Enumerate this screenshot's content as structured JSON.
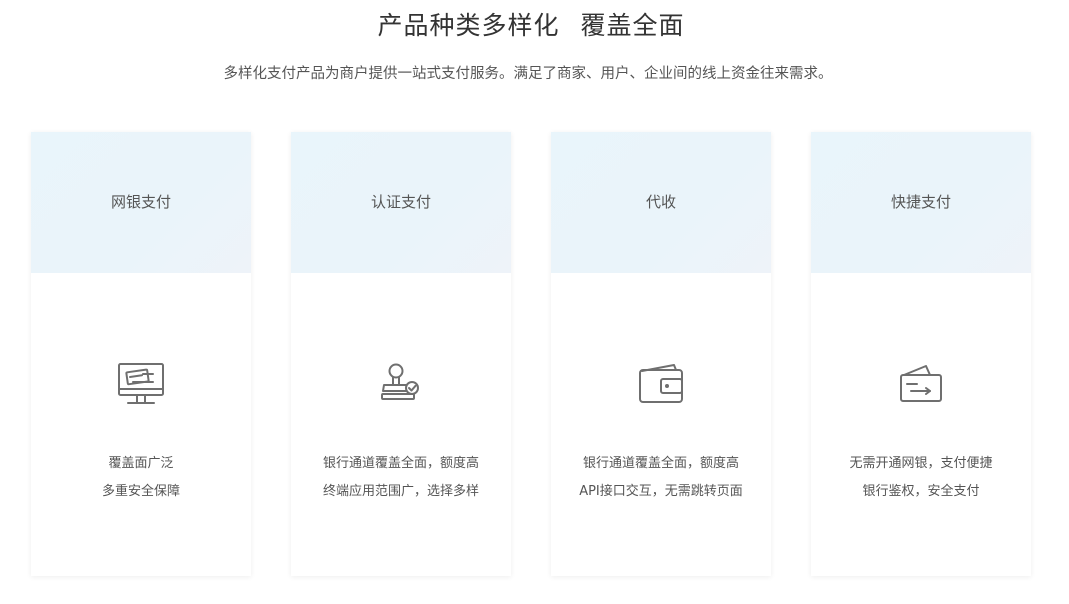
{
  "header": {
    "title": "产品种类多样化 覆盖全面",
    "subtitle": "多样化支付产品为商户提供一站式支付服务。满足了商家、用户、企业间的线上资金往来需求。"
  },
  "cards": [
    {
      "title": "网银支付",
      "icon": "monitor-card-icon",
      "line1": "覆盖面广泛",
      "line2": "多重安全保障"
    },
    {
      "title": "认证支付",
      "icon": "stamp-check-icon",
      "line1": "银行通道覆盖全面，额度高",
      "line2": "终端应用范围广，选择多样"
    },
    {
      "title": "代收",
      "icon": "wallet-icon",
      "line1": "银行通道覆盖全面，额度高",
      "line2": "API接口交互，无需跳转页面"
    },
    {
      "title": "快捷支付",
      "icon": "card-swipe-icon",
      "line1": "无需开通网银，支付便捷",
      "line2": "银行鉴权，安全支付"
    }
  ],
  "colors": {
    "card_header_bg": "#eaf4fa",
    "icon_stroke": "#6f6f6f",
    "text": "#555555"
  }
}
